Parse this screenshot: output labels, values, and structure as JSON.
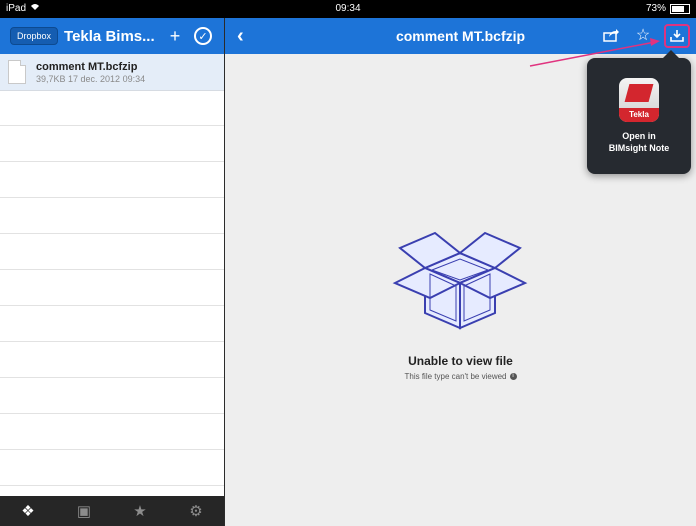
{
  "status_bar": {
    "device": "iPad",
    "wifi_icon": "wifi-icon",
    "time": "09:34",
    "battery": "73%"
  },
  "sidebar": {
    "dropbox_button": "Dropbox",
    "folder_title": "Tekla Bims...",
    "add_icon": "+",
    "files": [
      {
        "name": "comment MT.bcfzip",
        "meta": "39,7KB 17 dec. 2012 09:34"
      }
    ],
    "tabs": [
      {
        "icon": "dropbox-icon",
        "active": true
      },
      {
        "icon": "photos-icon",
        "active": false
      },
      {
        "icon": "star-icon",
        "active": false
      },
      {
        "icon": "gear-icon",
        "active": false
      }
    ]
  },
  "main": {
    "title": "comment MT.bcfzip",
    "message_title": "Unable to view file",
    "message_sub": "This file type can't be viewed"
  },
  "popover": {
    "app_icon_label": "Tekla",
    "action_label_line1": "Open in",
    "action_label_line2": "BIMsight Note"
  },
  "colors": {
    "nav_blue": "#1d74d8",
    "highlight_pink": "#e0337f",
    "popover_bg": "#262a30",
    "tekla_red": "#d3262e"
  }
}
